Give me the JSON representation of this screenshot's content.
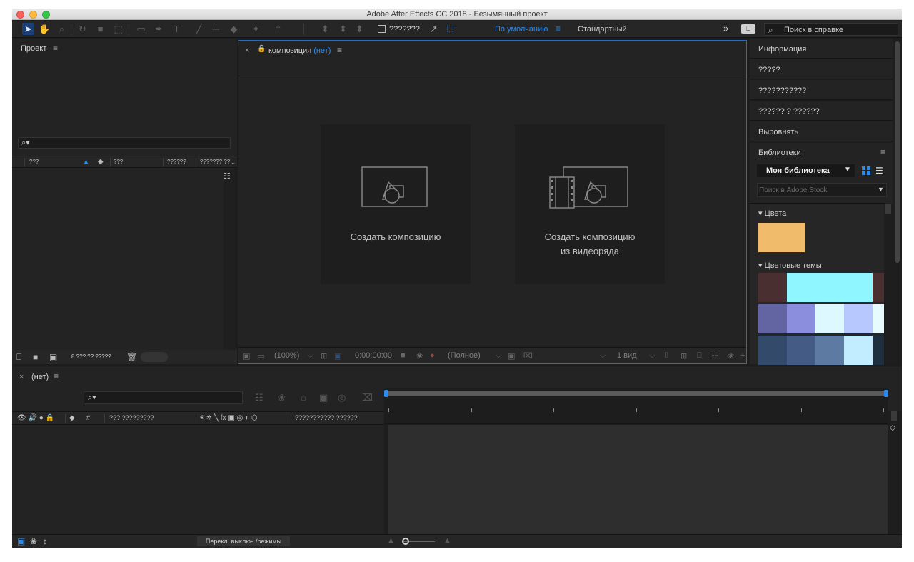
{
  "window": {
    "title": "Adobe After Effects CC 2018 - Безымянный проект"
  },
  "toolbar": {
    "snap_label": "???????",
    "workspace_default": "По умолчанию",
    "workspace_menu_glyph": "≡",
    "workspace_standard": "Стандартный",
    "more_glyph": "»",
    "search_placeholder": "Поиск в справке"
  },
  "project_panel": {
    "title": "Проект",
    "menu_glyph": "≡",
    "search_glyph": "⌕▾",
    "columns": [
      "???",
      "???",
      "??????",
      "??????? ??..."
    ],
    "footer_bpc": "8 ??? ?? ?????"
  },
  "composition_panel": {
    "close_glyph": "×",
    "label": "композиция",
    "value": "(нет)",
    "menu_glyph": "≡",
    "new_comp_label": "Создать композицию",
    "new_comp_footage_line1": "Создать композицию",
    "new_comp_footage_line2": "из видеоряда",
    "footer": {
      "zoom": "(100%)",
      "timecode": "0:00:00:00",
      "resolution": "(Полное)",
      "views": "1 вид",
      "caret": "⌵"
    }
  },
  "right_panels": {
    "info": "Информация",
    "audio": "?????",
    "preview": "???????????",
    "effects": "?????? ? ??????",
    "align": "Выровнять",
    "libraries": {
      "title": "Библиотеки",
      "menu_glyph": "≡",
      "library_name": "Моя библиотека",
      "caret": "▼",
      "list_glyph": "☰",
      "search_placeholder": "Поиск в Adobe Stock",
      "colors_section": "▾ Цвета",
      "themes_section": "▾ Цветовые темы",
      "color_swatch": "#f0bc6c",
      "themes": [
        [
          "#4a2f31",
          "#8ff5ff",
          "#8ff5ff",
          "#8ff5ff",
          "#4a2f31"
        ],
        [
          "#6365a3",
          "#8a8edc",
          "#def8ff",
          "#b7c8ff",
          "#e7fbff"
        ],
        [
          "#334a6b",
          "#445b86",
          "#5d7aa3",
          "#c2ecff",
          "#1e2f3f"
        ]
      ]
    }
  },
  "timeline_panel": {
    "close_glyph": "×",
    "label": "(нет)",
    "menu_glyph": "≡",
    "search_glyph": "⌕▾",
    "col_hash": "#",
    "col_source": "??? ?????????",
    "col_parent": "??????????? ??????",
    "switches_glyphs": "⍟ ✲ ╲ fx ▣ ◎ ◐ ⬡",
    "av_glyphs": "👁 🔊 ● 🔒",
    "toggle_button": "Перекл. выключ./режимы"
  }
}
